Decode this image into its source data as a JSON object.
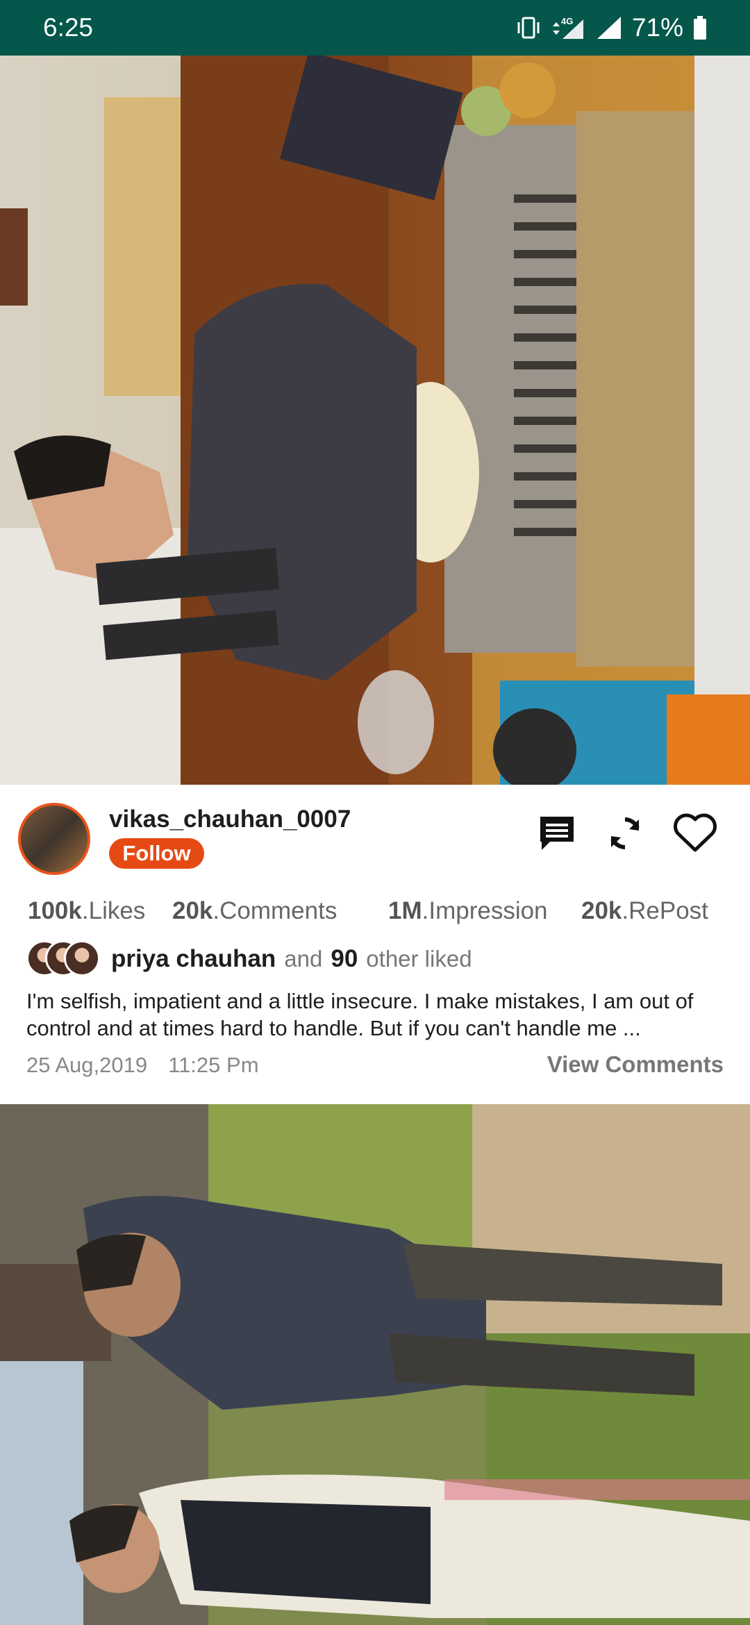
{
  "status_bar": {
    "time": "6:25",
    "battery": "71%",
    "network": "4G",
    "icons": [
      "vibrate-icon",
      "data-arrows-icon",
      "signal-icon",
      "signal-icon",
      "battery-icon"
    ]
  },
  "post": {
    "username": "vikas_chauhan_0007",
    "follow_label": "Follow",
    "actions": [
      "comment-icon",
      "repost-icon",
      "heart-icon"
    ],
    "stats": {
      "likes_value": "100k",
      "likes_label": ".Likes",
      "comments_value": "20k",
      "comments_label": ".Comments",
      "impression_value": "1M",
      "impression_label": ".Impression",
      "repost_value": "20k",
      "repost_label": ".RePost"
    },
    "liked_by": {
      "name": "priya chauhan",
      "and_text": "and",
      "count": "90",
      "suffix": "other liked"
    },
    "caption": "I'm selfish,  impatient and a little insecure. I make mistakes, I am out of control and at times hard to handle. But if you can't handle me ...",
    "date": "25 Aug,2019",
    "time": "11:25 Pm",
    "view_comments": "View Comments"
  },
  "colors": {
    "status_bar": "#04574a",
    "accent": "#e64a14",
    "text_dark": "#1e1e1e",
    "text_muted": "#888888"
  }
}
